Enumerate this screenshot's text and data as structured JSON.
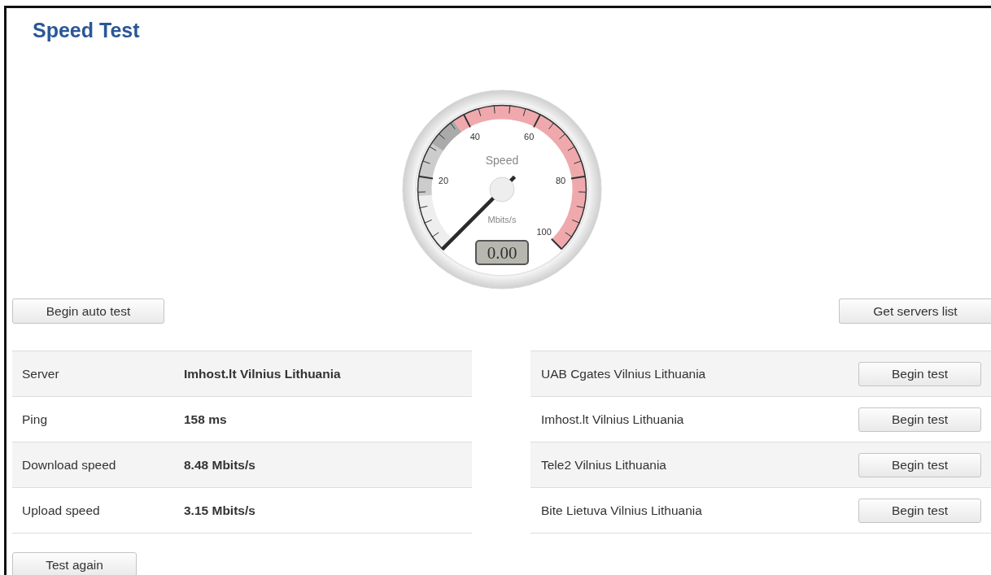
{
  "title": "Speed Test",
  "gauge": {
    "label": "Speed",
    "unit": "Mbits/s",
    "reading": "0.00",
    "scale": [
      "20",
      "40",
      "60",
      "80",
      "100"
    ]
  },
  "auto_test_button": "Begin auto test",
  "servers_list_button": "Get servers list",
  "results": [
    {
      "label": "Server",
      "value": "Imhost.lt Vilnius Lithuania"
    },
    {
      "label": "Ping",
      "value": "158 ms"
    },
    {
      "label": "Download speed",
      "value": "8.48 Mbits/s"
    },
    {
      "label": "Upload speed",
      "value": "3.15 Mbits/s"
    }
  ],
  "servers": [
    {
      "name": "UAB Cgates Vilnius Lithuania",
      "button": "Begin test"
    },
    {
      "name": "Imhost.lt Vilnius Lithuania",
      "button": "Begin test"
    },
    {
      "name": "Tele2 Vilnius Lithuania",
      "button": "Begin test"
    },
    {
      "name": "Bite Lietuva Vilnius Lithuania",
      "button": "Begin test"
    }
  ],
  "test_again_button": "Test again"
}
